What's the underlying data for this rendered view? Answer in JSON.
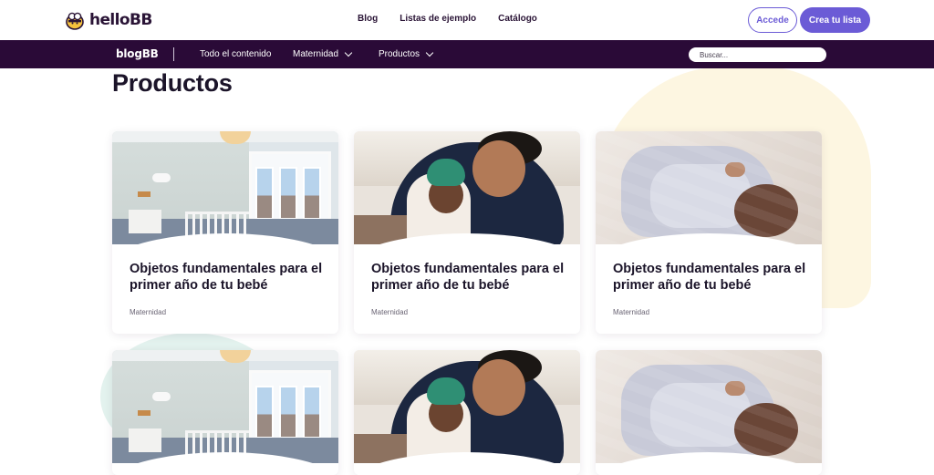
{
  "header": {
    "logo_text": "helloBB",
    "nav": [
      "Blog",
      "Listas de ejemplo",
      "Catálogo"
    ],
    "login_label": "Accede",
    "signup_label": "Crea tu lista",
    "accent_color": "#6b5bd6"
  },
  "subnav": {
    "brand": "blogBB",
    "items": [
      {
        "label": "Todo el contenido"
      },
      {
        "label": "Maternidad",
        "icon": "chevron-down-icon"
      },
      {
        "label": "Productos",
        "icon": "chevron-down-icon"
      }
    ],
    "search_placeholder": "Buscar...",
    "bar_color": "#2a0a37"
  },
  "page": {
    "title": "Productos"
  },
  "cards": [
    {
      "image": "nursery-photo",
      "title": "Objetos fundamentales para el primer año de tu bebé",
      "tag": "Maternidad"
    },
    {
      "image": "father-baby-photo",
      "title": "Objetos fundamentales para el primer año de tu bebé",
      "tag": "Maternidad"
    },
    {
      "image": "sleeping-baby-photo",
      "title": "Objetos fundamentales para el primer año de tu bebé",
      "tag": "Maternidad"
    },
    {
      "image": "nursery-photo"
    },
    {
      "image": "father-baby-photo"
    },
    {
      "image": "sleeping-baby-photo"
    }
  ]
}
